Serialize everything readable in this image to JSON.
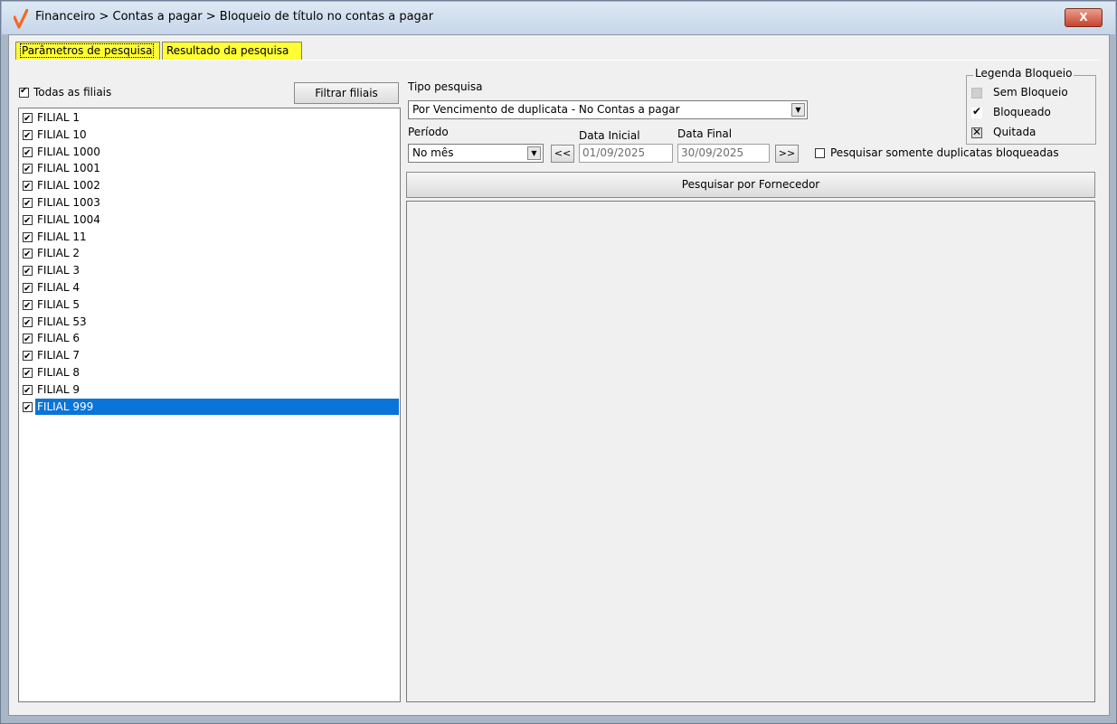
{
  "window": {
    "title": "Financeiro > Contas a pagar > Bloqueio de título no contas a pagar",
    "close_label": "X"
  },
  "tabs": [
    {
      "label": "Parâmetros de pesquisa"
    },
    {
      "label": "Resultado da pesquisa"
    }
  ],
  "filiais": {
    "all_label": "Todas as filiais",
    "all_checked": true,
    "filter_button": "Filtrar filiais",
    "items": [
      {
        "label": "FILIAL 1",
        "checked": true
      },
      {
        "label": "FILIAL 10",
        "checked": true
      },
      {
        "label": "FILIAL 1000",
        "checked": true
      },
      {
        "label": "FILIAL 1001",
        "checked": true
      },
      {
        "label": "FILIAL 1002",
        "checked": true
      },
      {
        "label": "FILIAL 1003",
        "checked": true
      },
      {
        "label": "FILIAL 1004",
        "checked": true
      },
      {
        "label": "FILIAL 11",
        "checked": true
      },
      {
        "label": "FILIAL 2",
        "checked": true
      },
      {
        "label": "FILIAL 3",
        "checked": true
      },
      {
        "label": "FILIAL 4",
        "checked": true
      },
      {
        "label": "FILIAL 5",
        "checked": true
      },
      {
        "label": "FILIAL 53",
        "checked": true
      },
      {
        "label": "FILIAL 6",
        "checked": true
      },
      {
        "label": "FILIAL 7",
        "checked": true
      },
      {
        "label": "FILIAL 8",
        "checked": true
      },
      {
        "label": "FILIAL 9",
        "checked": true
      },
      {
        "label": "FILIAL 999",
        "checked": true,
        "selected": true
      }
    ]
  },
  "search": {
    "tipo_label": "Tipo pesquisa",
    "tipo_value": "Por Vencimento de duplicata - No Contas a pagar",
    "periodo_label": "Período",
    "periodo_value": "No mês",
    "data_inicial_label": "Data Inicial",
    "data_inicial_value": "01/09/2025",
    "data_final_label": "Data Final",
    "data_final_value": "30/09/2025",
    "prev_label": "<<",
    "next_label": ">>",
    "only_blocked_label": "Pesquisar somente duplicatas bloqueadas",
    "only_blocked_checked": false,
    "search_button": "Pesquisar por Fornecedor"
  },
  "legend": {
    "title": "Legenda Bloqueio",
    "items": [
      {
        "label": "Sem Bloqueio",
        "icon": "grey-square-icon"
      },
      {
        "label": "Bloqueado",
        "icon": "check-mark-icon"
      },
      {
        "label": "Quitada",
        "icon": "x-mark-icon"
      }
    ]
  },
  "colors": {
    "tab_background": "#ffff33",
    "selection": "#0a74d9",
    "logo": "#f26a21"
  }
}
